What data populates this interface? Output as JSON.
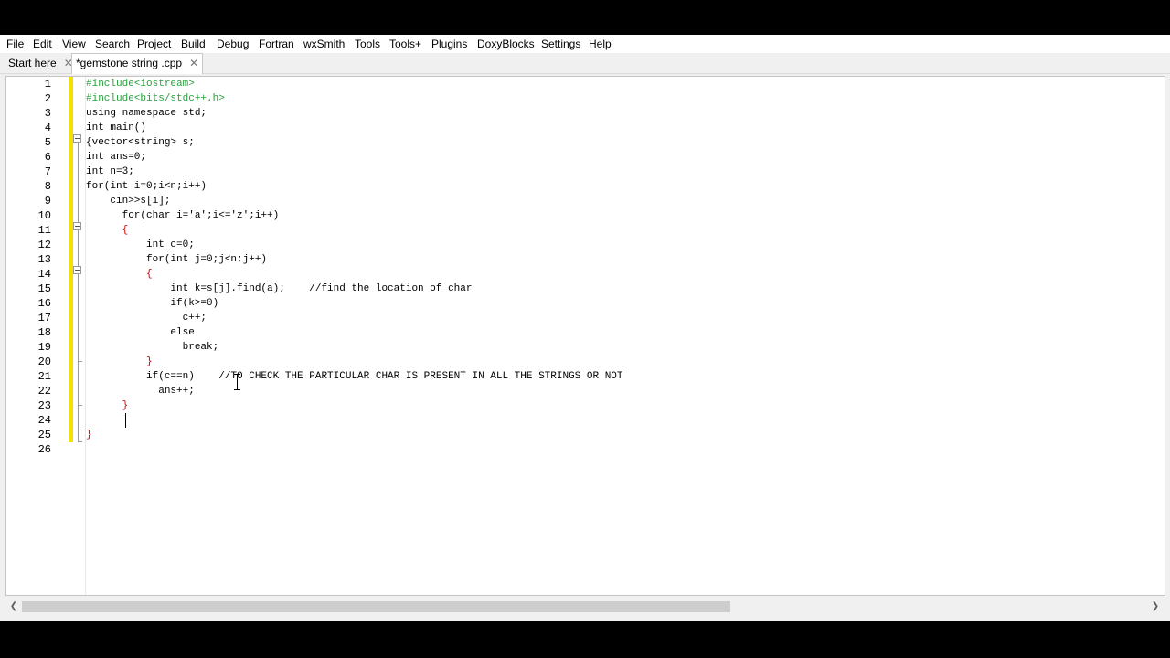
{
  "menu": [
    "File",
    "Edit",
    "View",
    "Search",
    "Project",
    "Build",
    "Debug",
    "Fortran",
    "wxSmith",
    "Tools",
    "Tools+",
    "Plugins",
    "DoxyBlocks",
    "Settings",
    "Help"
  ],
  "tabs": [
    {
      "label": "Start here",
      "close": "✕"
    },
    {
      "label": "*gemstone string .cpp",
      "close": "✕"
    }
  ],
  "line_numbers": [
    "1",
    "2",
    "3",
    "4",
    "5",
    "6",
    "7",
    "8",
    "9",
    "10",
    "11",
    "12",
    "13",
    "14",
    "15",
    "16",
    "17",
    "18",
    "19",
    "20",
    "21",
    "22",
    "23",
    "24",
    "25",
    "26"
  ],
  "code": [
    "#include<iostream>",
    "#include<bits/stdc++.h>",
    "using namespace std;",
    "int main()",
    "{vector<string> s;",
    "int ans=0;",
    "int n=3;",
    "for(int i=0;i<n;i++)",
    "    cin>>s[i];",
    "      for(char i='a';i<='z';i++)",
    "      {",
    "          int c=0;",
    "          for(int j=0;j<n;j++)",
    "          {",
    "              int k=s[j].find(a);    //find the location of char",
    "              if(k>=0)",
    "                c++;",
    "              else",
    "                break;",
    "          }",
    "          if(c==n)    //TO CHECK THE PARTICULAR CHAR IS PRESENT IN ALL THE STRINGS OR NOT",
    "            ans++;",
    "      }",
    "",
    "}",
    ""
  ],
  "scroll": {
    "left_arrow": "❮",
    "right_arrow": "❯"
  },
  "colors": {
    "keyword": "#00008b",
    "preprocessor": "#27a13a",
    "number": "#f0a000",
    "string": "#0000ff",
    "operator": "#cc0000",
    "comment": "#909090",
    "changebar": "#f5e000"
  }
}
